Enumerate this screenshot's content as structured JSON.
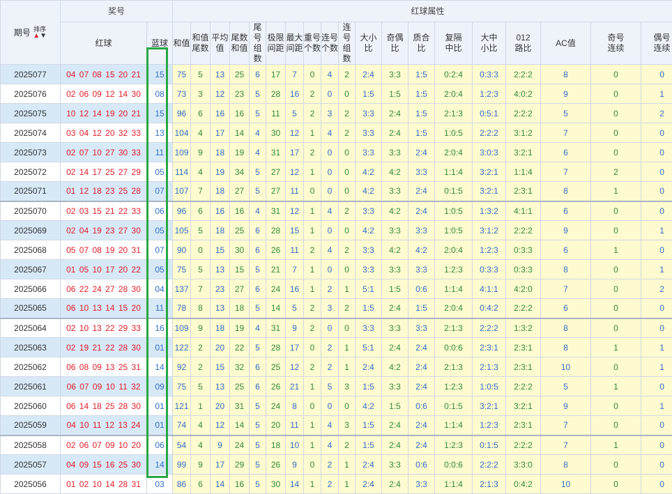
{
  "header": {
    "issue": "期号",
    "sort": "排序",
    "prize": "奖号",
    "red_ball": "红球",
    "blue_ball": "蓝球",
    "attributes": "红球属性",
    "columns": [
      "和值",
      "和值\n尾数",
      "平均\n值",
      "尾数\n和值",
      "尾号\n组数",
      "极限\n间距",
      "最大\n间距",
      "重号\n个数",
      "连号\n个数",
      "连号\n组数",
      "大小\n比",
      "奇偶\n比",
      "质合\n比",
      "复隔\n中比",
      "大中\n小比",
      "012\n路比",
      "AC值",
      "奇号\n连续",
      "偶号\n连续"
    ]
  },
  "rows": [
    {
      "issue": "2025077",
      "red": "04 07 08 15 20 21",
      "blue": "15",
      "attrs": [
        "75",
        "5",
        "13",
        "25",
        "6",
        "17",
        "7",
        "0",
        "4",
        "2",
        "2:4",
        "3:3",
        "1:5",
        "0:2:4",
        "0:3:3",
        "2:2:2",
        "8",
        "0",
        "0"
      ]
    },
    {
      "issue": "2025076",
      "red": "02 06 09 12 14 30",
      "blue": "08",
      "attrs": [
        "73",
        "3",
        "12",
        "23",
        "5",
        "28",
        "16",
        "2",
        "0",
        "0",
        "1:5",
        "1:5",
        "1:5",
        "2:0:4",
        "1:2:3",
        "4:0:2",
        "9",
        "0",
        "1"
      ]
    },
    {
      "issue": "2025075",
      "red": "10 12 14 19 20 21",
      "blue": "15",
      "attrs": [
        "96",
        "6",
        "16",
        "16",
        "5",
        "11",
        "5",
        "2",
        "3",
        "2",
        "3:3",
        "2:4",
        "1:5",
        "2:1:3",
        "0:5:1",
        "2:2:2",
        "5",
        "0",
        "2"
      ]
    },
    {
      "issue": "2025074",
      "red": "03 04 12 20 32 33",
      "blue": "13",
      "attrs": [
        "104",
        "4",
        "17",
        "14",
        "4",
        "30",
        "12",
        "1",
        "4",
        "2",
        "3:3",
        "2:4",
        "1:5",
        "1:0:5",
        "2:2:2",
        "3:1:2",
        "7",
        "0",
        "0"
      ]
    },
    {
      "issue": "2025073",
      "red": "02 07 10 27 30 33",
      "blue": "11",
      "attrs": [
        "109",
        "9",
        "18",
        "19",
        "4",
        "31",
        "17",
        "2",
        "0",
        "0",
        "3:3",
        "3:3",
        "2:4",
        "2:0:4",
        "3:0:3",
        "3:2:1",
        "6",
        "0",
        "0"
      ]
    },
    {
      "issue": "2025072",
      "red": "02 14 17 25 27 29",
      "blue": "05",
      "attrs": [
        "114",
        "4",
        "19",
        "34",
        "5",
        "27",
        "12",
        "1",
        "0",
        "0",
        "4:2",
        "4:2",
        "3:3",
        "1:1:4",
        "3:2:1",
        "1:1:4",
        "7",
        "2",
        "0"
      ]
    },
    {
      "issue": "2025071",
      "red": "01 12 18 23 25 28",
      "blue": "07",
      "attrs": [
        "107",
        "7",
        "18",
        "27",
        "5",
        "27",
        "11",
        "0",
        "0",
        "0",
        "4:2",
        "3:3",
        "2:4",
        "0:1:5",
        "3:2:1",
        "2:3:1",
        "8",
        "1",
        "0"
      ]
    },
    {
      "issue": "2025070",
      "red": "02 03 15 21 22 33",
      "blue": "06",
      "attrs": [
        "96",
        "6",
        "16",
        "16",
        "4",
        "31",
        "12",
        "1",
        "4",
        "2",
        "3:3",
        "4:2",
        "2:4",
        "1:0:5",
        "1:3:2",
        "4:1:1",
        "6",
        "0",
        "0"
      ]
    },
    {
      "issue": "2025069",
      "red": "02 04 19 23 27 30",
      "blue": "05",
      "attrs": [
        "105",
        "5",
        "18",
        "25",
        "6",
        "28",
        "15",
        "1",
        "0",
        "0",
        "4:2",
        "3:3",
        "3:3",
        "1:0:5",
        "3:1:2",
        "2:2:2",
        "9",
        "0",
        "1"
      ]
    },
    {
      "issue": "2025068",
      "red": "05 07 08 19 20 31",
      "blue": "07",
      "attrs": [
        "90",
        "0",
        "15",
        "30",
        "6",
        "26",
        "11",
        "2",
        "4",
        "2",
        "3:3",
        "4:2",
        "4:2",
        "2:0:4",
        "1:2:3",
        "0:3:3",
        "6",
        "1",
        "0"
      ]
    },
    {
      "issue": "2025067",
      "red": "01 05 10 17 20 22",
      "blue": "05",
      "attrs": [
        "75",
        "5",
        "13",
        "15",
        "5",
        "21",
        "7",
        "1",
        "0",
        "0",
        "3:3",
        "3:3",
        "3:3",
        "1:2:3",
        "0:3:3",
        "0:3:3",
        "8",
        "0",
        "1"
      ]
    },
    {
      "issue": "2025066",
      "red": "06 22 24 27 28 30",
      "blue": "04",
      "attrs": [
        "137",
        "7",
        "23",
        "27",
        "6",
        "24",
        "16",
        "1",
        "2",
        "1",
        "5:1",
        "1:5",
        "0:6",
        "1:1:4",
        "4:1:1",
        "4:2:0",
        "7",
        "0",
        "2"
      ]
    },
    {
      "issue": "2025065",
      "red": "06 10 13 14 15 20",
      "blue": "11",
      "attrs": [
        "78",
        "8",
        "13",
        "18",
        "5",
        "14",
        "5",
        "2",
        "3",
        "2",
        "1:5",
        "2:4",
        "1:5",
        "2:0:4",
        "0:4:2",
        "2:2:2",
        "6",
        "0",
        "0"
      ]
    },
    {
      "issue": "2025064",
      "red": "02 10 13 22 29 33",
      "blue": "16",
      "attrs": [
        "109",
        "9",
        "18",
        "19",
        "4",
        "31",
        "9",
        "2",
        "0",
        "0",
        "3:3",
        "3:3",
        "3:3",
        "2:1:3",
        "2:2:2",
        "1:3:2",
        "8",
        "0",
        "0"
      ]
    },
    {
      "issue": "2025063",
      "red": "02 19 21 22 28 30",
      "blue": "01",
      "attrs": [
        "122",
        "2",
        "20",
        "22",
        "5",
        "28",
        "17",
        "0",
        "2",
        "1",
        "5:1",
        "2:4",
        "2:4",
        "0:0:6",
        "2:3:1",
        "2:3:1",
        "8",
        "1",
        "1"
      ]
    },
    {
      "issue": "2025062",
      "red": "06 08 09 13 25 31",
      "blue": "14",
      "attrs": [
        "92",
        "2",
        "15",
        "32",
        "6",
        "25",
        "12",
        "2",
        "2",
        "1",
        "2:4",
        "4:2",
        "2:4",
        "2:1:3",
        "2:1:3",
        "2:3:1",
        "10",
        "0",
        "1"
      ]
    },
    {
      "issue": "2025061",
      "red": "06 07 09 10 11 32",
      "blue": "09",
      "attrs": [
        "75",
        "5",
        "13",
        "25",
        "6",
        "26",
        "21",
        "1",
        "5",
        "3",
        "1:5",
        "3:3",
        "2:4",
        "1:2:3",
        "1:0:5",
        "2:2:2",
        "5",
        "1",
        "0"
      ]
    },
    {
      "issue": "2025060",
      "red": "06 14 18 25 28 30",
      "blue": "01",
      "attrs": [
        "121",
        "1",
        "20",
        "31",
        "5",
        "24",
        "8",
        "0",
        "0",
        "0",
        "4:2",
        "1:5",
        "0:6",
        "0:1:5",
        "3:2:1",
        "3:2:1",
        "9",
        "0",
        "1"
      ]
    },
    {
      "issue": "2025059",
      "red": "04 10 11 12 13 24",
      "blue": "01",
      "attrs": [
        "74",
        "4",
        "12",
        "14",
        "5",
        "20",
        "11",
        "1",
        "4",
        "3",
        "1:5",
        "2:4",
        "2:4",
        "1:1:4",
        "1:2:3",
        "2:3:1",
        "7",
        "0",
        "0"
      ]
    },
    {
      "issue": "2025058",
      "red": "02 06 07 09 10 20",
      "blue": "06",
      "attrs": [
        "54",
        "4",
        "9",
        "24",
        "5",
        "18",
        "10",
        "1",
        "4",
        "2",
        "1:5",
        "2:4",
        "2:4",
        "1:2:3",
        "0:1:5",
        "2:2:2",
        "7",
        "1",
        "0"
      ]
    },
    {
      "issue": "2025057",
      "red": "04 09 15 16 25 30",
      "blue": "14",
      "attrs": [
        "99",
        "9",
        "17",
        "29",
        "5",
        "26",
        "9",
        "0",
        "2",
        "1",
        "2:4",
        "3:3",
        "0:6",
        "0:0:6",
        "2:2:2",
        "3:3:0",
        "8",
        "0",
        "0"
      ]
    },
    {
      "issue": "2025056",
      "red": "01 02 10 14 28 31",
      "blue": "03",
      "attrs": [
        "86",
        "6",
        "14",
        "16",
        "5",
        "30",
        "14",
        "1",
        "2",
        "1",
        "2:4",
        "2:4",
        "3:3",
        "1:1:4",
        "2:1:3",
        "0:4:2",
        "10",
        "0",
        "0"
      ]
    }
  ]
}
